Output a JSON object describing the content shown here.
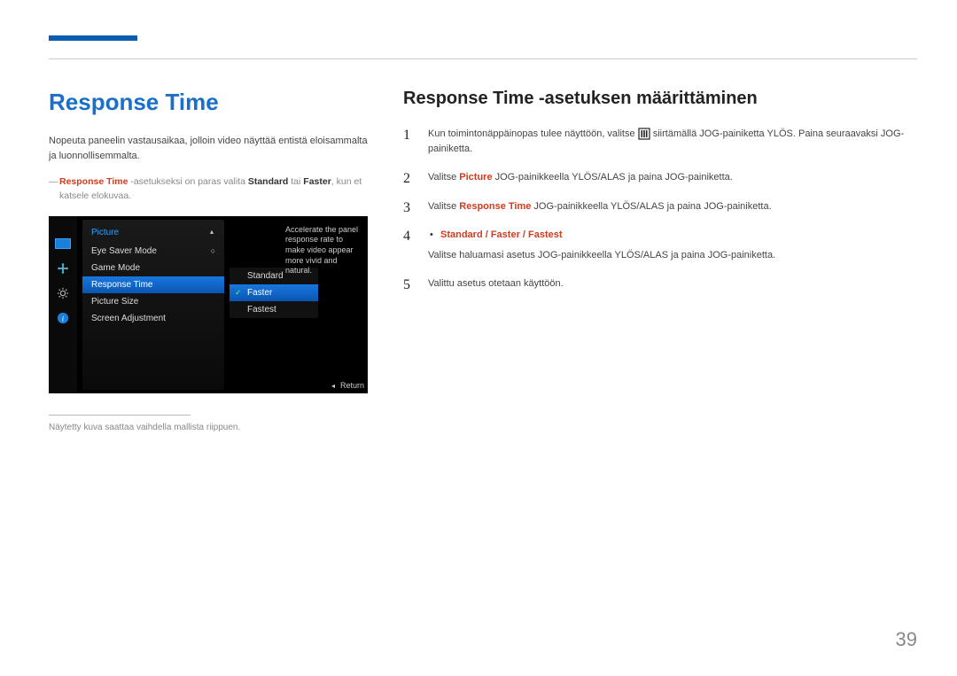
{
  "page_number": "39",
  "left": {
    "title": "Response Time",
    "intro": "Nopeuta paneelin vastausaikaa, jolloin video näyttää entistä eloisammalta ja luonnollisemmalta.",
    "note_pre": "Response Time",
    "note_mid1": " -asetukseksi on paras valita ",
    "note_strong1": "Standard",
    "note_mid2": " tai ",
    "note_strong2": "Faster",
    "note_post": ", kun et katsele elokuvaa.",
    "footnote": "Näytetty kuva saattaa vaihdella mallista riippuen."
  },
  "osd": {
    "menu_title": "Picture",
    "items": [
      {
        "label": "Eye Saver Mode",
        "mark": "○"
      },
      {
        "label": "Game Mode"
      },
      {
        "label": "Response Time"
      },
      {
        "label": "Picture Size"
      },
      {
        "label": "Screen Adjustment"
      }
    ],
    "selected_index": 2,
    "options": [
      "Standard",
      "Faster",
      "Fastest"
    ],
    "option_selected_index": 1,
    "desc": "Accelerate the panel response rate to make video appear more vivid and natural.",
    "return": "Return"
  },
  "right": {
    "heading": "Response Time -asetuksen määrittäminen",
    "steps": [
      {
        "pre": "Kun toimintonäppäinopas tulee näyttöön, valitse ",
        "post": " siirtämällä JOG-painiketta YLÖS. Paina seuraavaksi JOG-painiketta."
      },
      {
        "pre": "Valitse ",
        "red": "Picture",
        "post": " JOG-painikkeella YLÖS/ALAS ja paina JOG-painiketta."
      },
      {
        "pre": "Valitse ",
        "red": "Response Time",
        "post": " JOG-painikkeella YLÖS/ALAS ja paina JOG-painiketta."
      },
      {
        "text": "Valitse haluamasi asetus JOG-painikkeella YLÖS/ALAS ja paina JOG-painiketta.",
        "bullet": "Standard / Faster / Fastest"
      },
      {
        "text": "Valittu asetus otetaan käyttöön."
      }
    ]
  }
}
